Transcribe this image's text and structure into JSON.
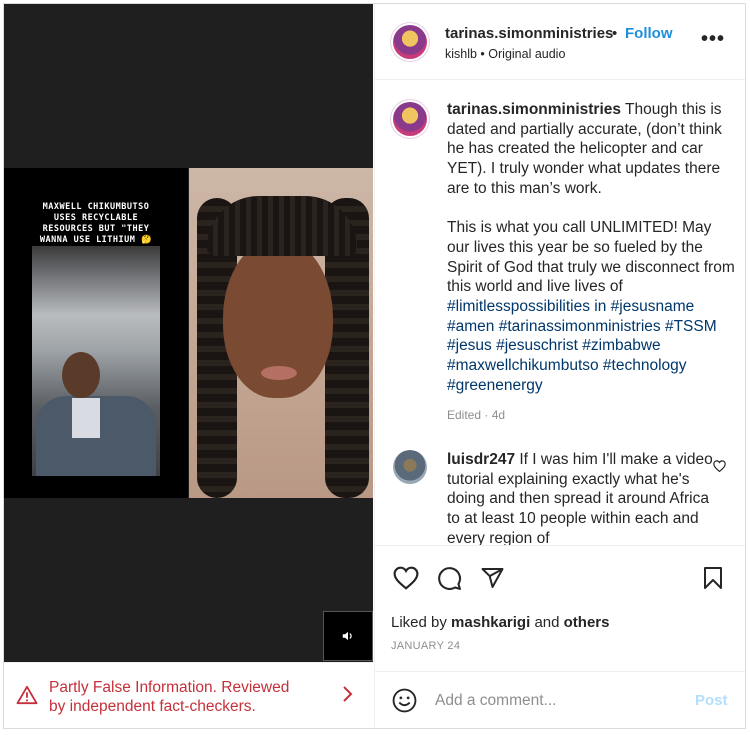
{
  "post": {
    "media": {
      "overlay_text": "MAXWELL CHIKUMBUTSO USES RECYCLABLE RESOURCES BUT \"THEY WANNA USE LITHIUM 🤔",
      "mute_icon": "speaker-icon"
    },
    "fact_check": {
      "text": "Partly False Information. Reviewed by independent fact-checkers.",
      "color": "#c5303a"
    },
    "header": {
      "username": "tarinas.simonministries",
      "separator": "•",
      "follow_label": "Follow",
      "audio": "kishlb • Original audio",
      "more": "•••"
    },
    "caption": {
      "username": "tarinas.simonministries",
      "text": "Though this is dated and partially accurate, (don’t think he has created the helicopter and car YET). I truly wonder what updates there are to this man’s work.",
      "text2": "This is what you call UNLIMITED! May our lives this year be so fueled by the Spirit of God that truly we disconnect from this world and live lives of",
      "hashtags": "#limitlesspossibilities in #jesusname #amen #tarinassimonministries #TSSM #jesus #jesuschrist #zimbabwe #maxwellchikumbutso #technology #greenenergy",
      "meta": "Edited · 4d"
    },
    "comment": {
      "username": "luisdr247",
      "text": "If I was him I'll make a video tutorial explaining exactly what he's doing and then spread it around Africa to at least 10 people within each and every region of"
    },
    "likes": {
      "prefix": "Liked by",
      "user": "mashkarigi",
      "and": "and",
      "others": "others"
    },
    "date": "JANUARY 24",
    "add_comment": {
      "placeholder": "Add a comment...",
      "post_label": "Post"
    },
    "colors": {
      "link": "#1e8fd8",
      "hashtag": "#00376b",
      "post_disabled": "#b2dffc"
    }
  }
}
